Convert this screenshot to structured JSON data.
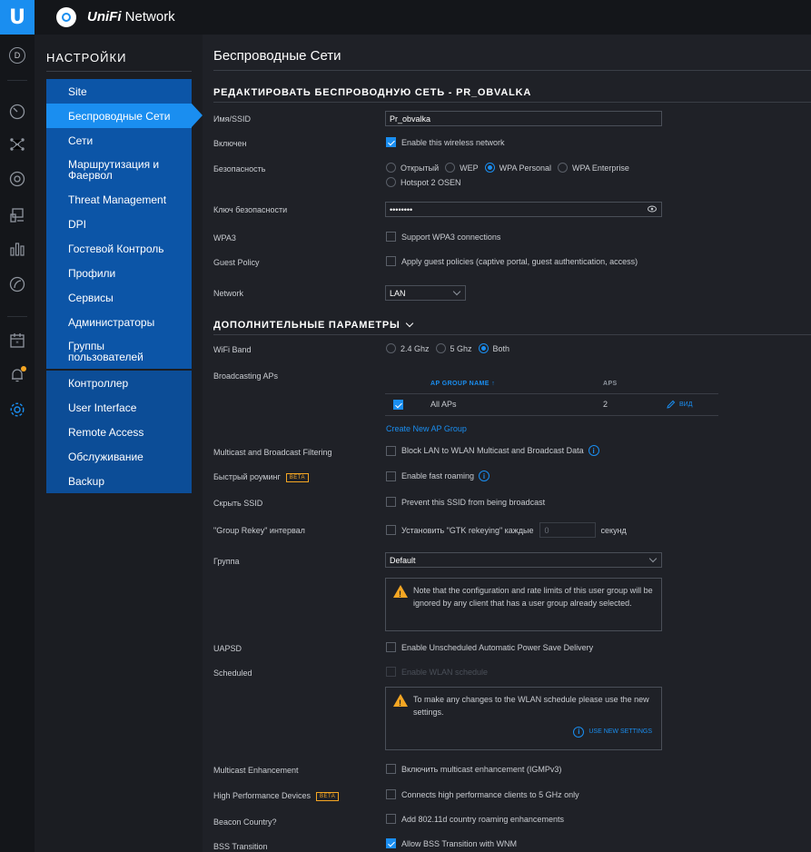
{
  "app": {
    "brand_name": "UniFi",
    "brand_suffix": "Network",
    "logo_letter": "U",
    "avatar_initial": "D"
  },
  "sidebar": {
    "title": "НАСТРОЙКИ",
    "items": [
      {
        "label": "Site"
      },
      {
        "label": "Беспроводные Сети"
      },
      {
        "label": "Сети"
      },
      {
        "label": "Маршрутизация и Фаервол"
      },
      {
        "label": "Threat Management"
      },
      {
        "label": "DPI"
      },
      {
        "label": "Гостевой Контроль"
      },
      {
        "label": "Профили"
      },
      {
        "label": "Сервисы"
      },
      {
        "label": "Администраторы"
      },
      {
        "label": "Группы пользователей"
      },
      {
        "label": "Контроллер"
      },
      {
        "label": "User Interface"
      },
      {
        "label": "Remote Access"
      },
      {
        "label": "Обслуживание"
      },
      {
        "label": "Backup"
      }
    ]
  },
  "main": {
    "page_title": "Беспроводные Сети",
    "edit_header": "РЕДАКТИРОВАТЬ БЕСПРОВОДНУЮ СЕТЬ - PR_OBVALKA",
    "ssid_label": "Имя/SSID",
    "ssid_value": "Pr_obvalka",
    "enabled_label": "Включен",
    "enabled_text": "Enable this wireless network",
    "security_label": "Безопасность",
    "security_options": [
      "Открытый",
      "WEP",
      "WPA Personal",
      "WPA Enterprise",
      "Hotspot 2 OSEN"
    ],
    "key_label": "Ключ безопасности",
    "key_value": "••••••••",
    "wpa3_label": "WPA3",
    "wpa3_text": "Support WPA3 connections",
    "guest_label": "Guest Policy",
    "guest_text": "Apply guest policies (captive portal, guest authentication, access)",
    "network_label": "Network",
    "network_value": "LAN",
    "advanced_header": "ДОПОЛНИТЕЛЬНЫЕ ПАРАМЕТРЫ",
    "wifiband_label": "WiFi Band",
    "band_options": [
      "2.4 Ghz",
      "5 Ghz",
      "Both"
    ],
    "broadcasting_label": "Broadcasting APs",
    "ap_table": {
      "col_name": "AP GROUP NAME",
      "col_aps": "APS",
      "rows": [
        {
          "name": "All APs",
          "aps": "2",
          "action": "ВИД"
        }
      ]
    },
    "create_ap_group": "Create New AP Group",
    "multicast_label": "Multicast and Broadcast Filtering",
    "multicast_text": "Block LAN to WLAN Multicast and Broadcast Data",
    "fastroam_label": "Быстрый роуминг",
    "beta": "BETA",
    "fastroam_text": "Enable fast roaming",
    "hide_label": "Скрыть SSID",
    "hide_text": "Prevent this SSID from being broadcast",
    "rekey_label": "\"Group Rekey\" интервал",
    "rekey_text": "Установить \"GTK rekeying\" каждые",
    "rekey_value": "0",
    "rekey_unit": "секунд",
    "group_label": "Группа",
    "group_value": "Default",
    "group_note": "Note that the configuration and rate limits of this user group will be ignored by any client that has a user group already selected.",
    "uapsd_label": "UAPSD",
    "uapsd_text": "Enable Unscheduled Automatic Power Save Delivery",
    "scheduled_label": "Scheduled",
    "scheduled_text": "Enable WLAN schedule",
    "schedule_note": "To make any changes to the WLAN schedule please use the new settings.",
    "use_new_settings": "USE NEW SETTINGS",
    "mcast_enh_label": "Multicast Enhancement",
    "mcast_enh_text": "Включить multicast enhancement (IGMPv3)",
    "hpd_label": "High Performance Devices",
    "hpd_text": "Connects high performance clients to 5 GHz only",
    "beacon_label": "Beacon Country?",
    "beacon_text": "Add 802.11d country roaming enhancements",
    "bss_label": "BSS Transition",
    "bss_text": "Allow BSS Transition with WNM"
  },
  "colors": {
    "accent": "#1a8ef0",
    "nav_bg": "#0c55a7",
    "warning": "#f5a623"
  }
}
